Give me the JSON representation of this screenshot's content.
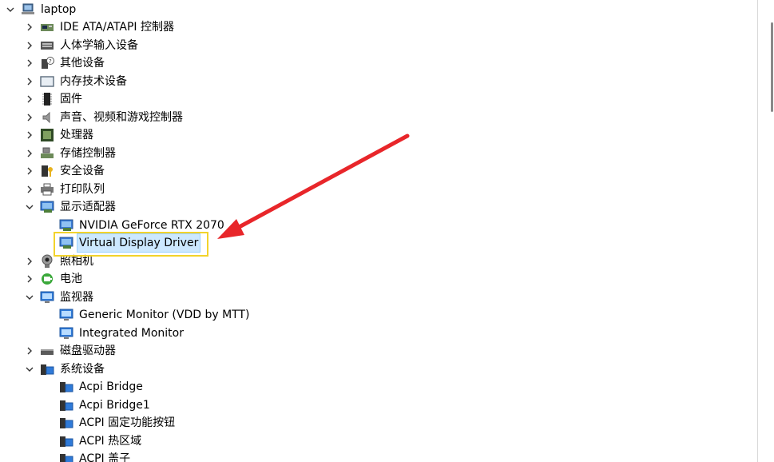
{
  "root": {
    "label": "laptop"
  },
  "items": [
    {
      "label": "IDE ATA/ATAPI 控制器",
      "icon": "ide-controller-icon"
    },
    {
      "label": "人体学输入设备",
      "icon": "hid-device-icon"
    },
    {
      "label": "其他设备",
      "icon": "unknown-device-icon"
    },
    {
      "label": "内存技术设备",
      "icon": "memory-device-icon"
    },
    {
      "label": "固件",
      "icon": "firmware-icon"
    },
    {
      "label": "声音、视频和游戏控制器",
      "icon": "speaker-icon"
    },
    {
      "label": "处理器",
      "icon": "processor-icon"
    },
    {
      "label": "存储控制器",
      "icon": "storage-controller-icon"
    },
    {
      "label": "安全设备",
      "icon": "security-device-icon"
    },
    {
      "label": "打印队列",
      "icon": "printer-icon"
    },
    {
      "label": "显示适配器",
      "icon": "display-adapter-icon",
      "children": [
        {
          "label": "NVIDIA GeForce RTX 2070"
        },
        {
          "label": "Virtual Display Driver"
        }
      ]
    },
    {
      "label": "照相机",
      "icon": "camera-icon"
    },
    {
      "label": "电池",
      "icon": "battery-icon"
    },
    {
      "label": "监视器",
      "icon": "monitor-icon",
      "children": [
        {
          "label": "Generic Monitor (VDD by MTT)"
        },
        {
          "label": "Integrated Monitor"
        }
      ]
    },
    {
      "label": "磁盘驱动器",
      "icon": "disk-drive-icon"
    },
    {
      "label": "系统设备",
      "icon": "system-device-icon",
      "children": [
        {
          "label": "Acpi Bridge"
        },
        {
          "label": "Acpi Bridge1"
        },
        {
          "label": "ACPI 固定功能按钮"
        },
        {
          "label": "ACPI 热区域"
        },
        {
          "label": "ACPI 盖子"
        }
      ]
    }
  ],
  "colors": {
    "highlight_box": "#f2d32c",
    "arrow": "#e8262a",
    "selection": "#cce8ff"
  }
}
